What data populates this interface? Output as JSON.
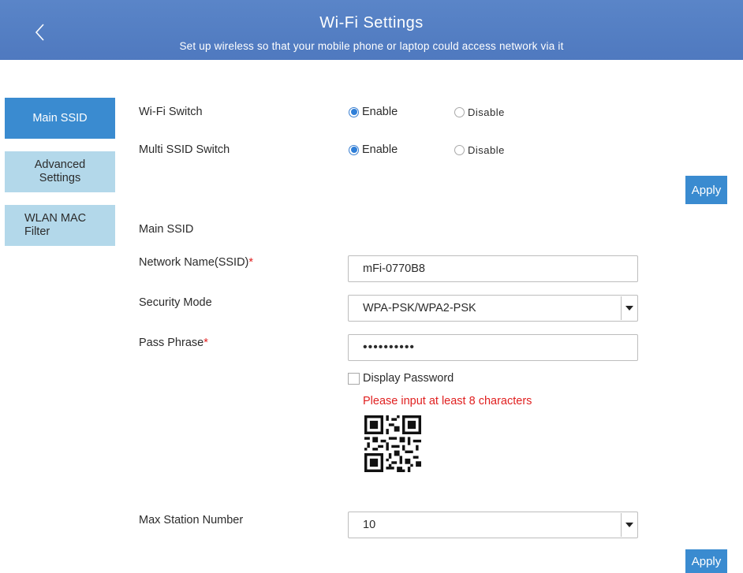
{
  "header": {
    "title": "Wi-Fi Settings",
    "subtitle": "Set up wireless so that your mobile phone or laptop could access network via it"
  },
  "sidebar": {
    "items": [
      {
        "label": "Main SSID"
      },
      {
        "label": "Advanced\nSettings"
      },
      {
        "label": "WLAN MAC\nFilter"
      }
    ]
  },
  "switches": {
    "wifi_switch": {
      "label": "Wi-Fi Switch",
      "enable": "Enable",
      "disable": "Disable",
      "selected": "Enable"
    },
    "multi_ssid_switch": {
      "label": "Multi SSID Switch",
      "enable": "Enable",
      "disable": "Disable",
      "selected": "Enable"
    }
  },
  "apply_label": "Apply",
  "main_ssid": {
    "section_title": "Main SSID",
    "network_name_label": "Network Name(SSID)",
    "network_name_value": "mFi-0770B8",
    "security_mode_label": "Security Mode",
    "security_mode_value": "WPA-PSK/WPA2-PSK",
    "pass_phrase_label": "Pass Phrase",
    "pass_phrase_value": "••••••••••",
    "display_password_label": "Display Password",
    "error_text": "Please input at least 8 characters",
    "required_mark": "*"
  },
  "max_station": {
    "label": "Max Station Number",
    "value": "10"
  },
  "icons": {
    "back": "chevron-left-icon",
    "dropdown": "triangle-down-icon",
    "qr": "qr-code"
  },
  "colors": {
    "header": "#5281c4",
    "accent": "#3a8bd0",
    "sidebar_inactive": "#b3d8ea",
    "error": "#e02020"
  }
}
